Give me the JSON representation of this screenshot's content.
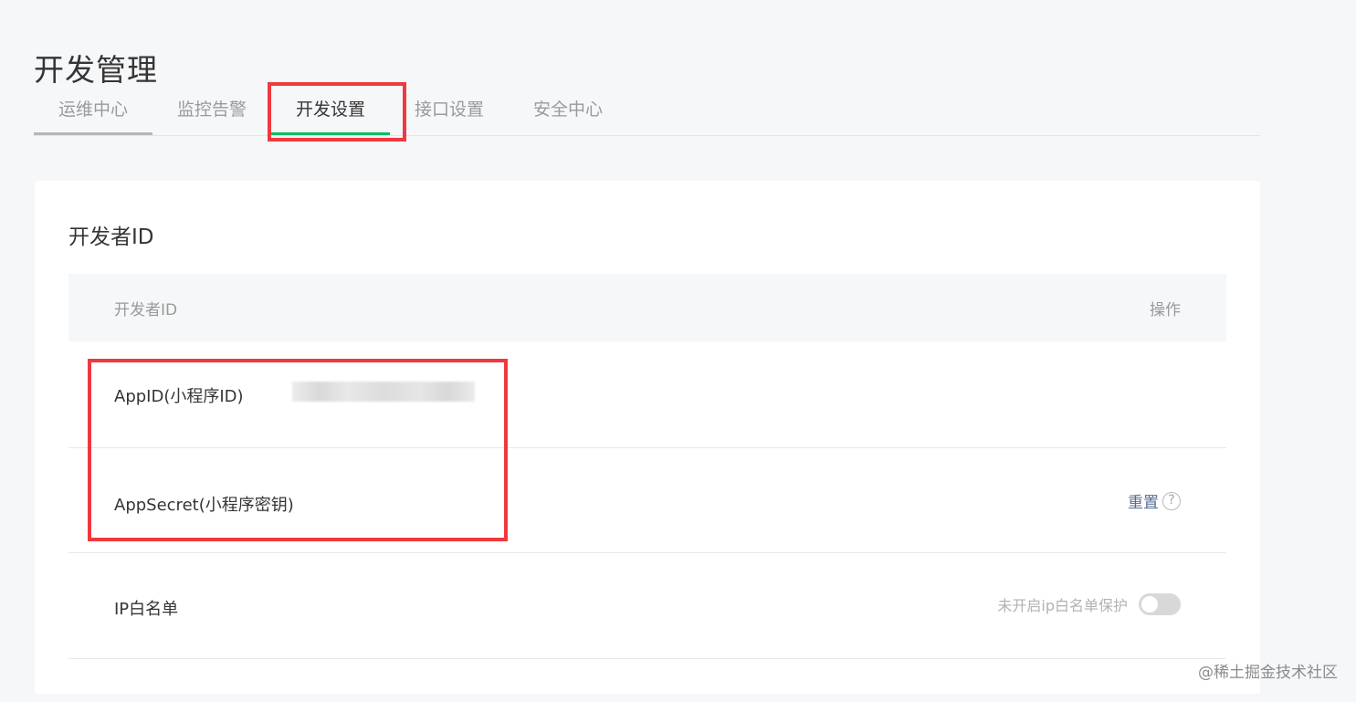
{
  "page": {
    "title": "开发管理"
  },
  "tabs": [
    {
      "label": "运维中心"
    },
    {
      "label": "监控告警"
    },
    {
      "label": "开发设置",
      "active": true
    },
    {
      "label": "接口设置"
    },
    {
      "label": "安全中心"
    }
  ],
  "card": {
    "title": "开发者ID",
    "table": {
      "columns": [
        "开发者ID",
        "操作"
      ],
      "rows": [
        {
          "label": "AppID(小程序ID)",
          "value": ""
        },
        {
          "label": "AppSecret(小程序密钥)",
          "action": "重置",
          "help_icon": "question-circle-icon"
        },
        {
          "label": "IP白名单",
          "status": "未开启ip白名单保护",
          "toggle_on": false
        }
      ]
    }
  },
  "watermark": "@稀土掘金技术社区",
  "colors": {
    "accent": "#07c160",
    "highlight": "#f0393e",
    "link": "#576b95"
  }
}
